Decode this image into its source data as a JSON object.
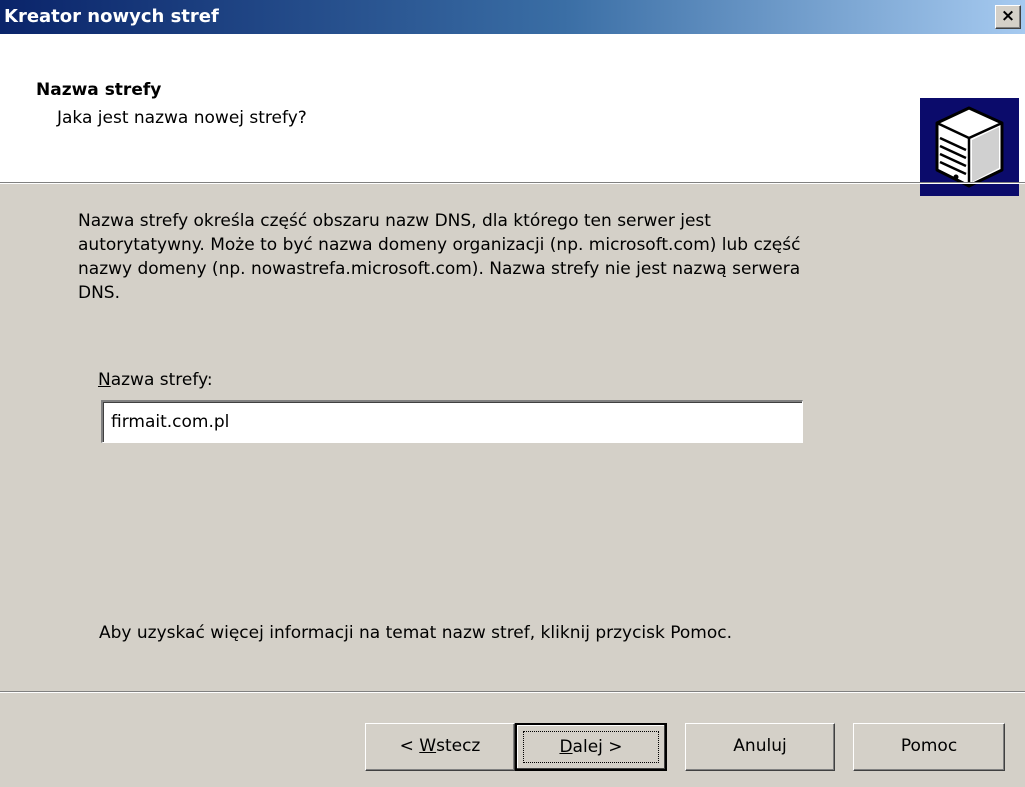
{
  "window": {
    "title": "Kreator nowych stref",
    "close_label": "×"
  },
  "header": {
    "title": "Nazwa strefy",
    "subtitle": "Jaka jest nazwa nowej strefy?",
    "icon": "server-icon"
  },
  "description": {
    "lines": [
      "Nazwa strefy określa część obszaru nazw DNS, dla którego ten serwer jest",
      "autorytatywny. Może to być nazwa domeny organizacji (np. microsoft.com) lub część",
      "nazwy domeny (np. nowastrefa.microsoft.com). Nazwa strefy nie jest nazwą serwera",
      "DNS."
    ]
  },
  "zone_field": {
    "label_accel": "N",
    "label_rest": "azwa strefy:",
    "value": "firmait.com.pl"
  },
  "help_note": "Aby uzyskać więcej informacji na temat nazw stref, kliknij przycisk Pomoc.",
  "buttons": {
    "back_prefix": "< ",
    "back_accel": "W",
    "back_rest": "stecz",
    "next_accel": "D",
    "next_rest": "alej >",
    "cancel": "Anuluj",
    "help": "Pomoc"
  },
  "colors": {
    "titlebar_start": "#0a246a",
    "titlebar_end": "#a6caf0",
    "dialog_bg": "#d4d0c8",
    "icon_bg": "#0b0b6b"
  }
}
